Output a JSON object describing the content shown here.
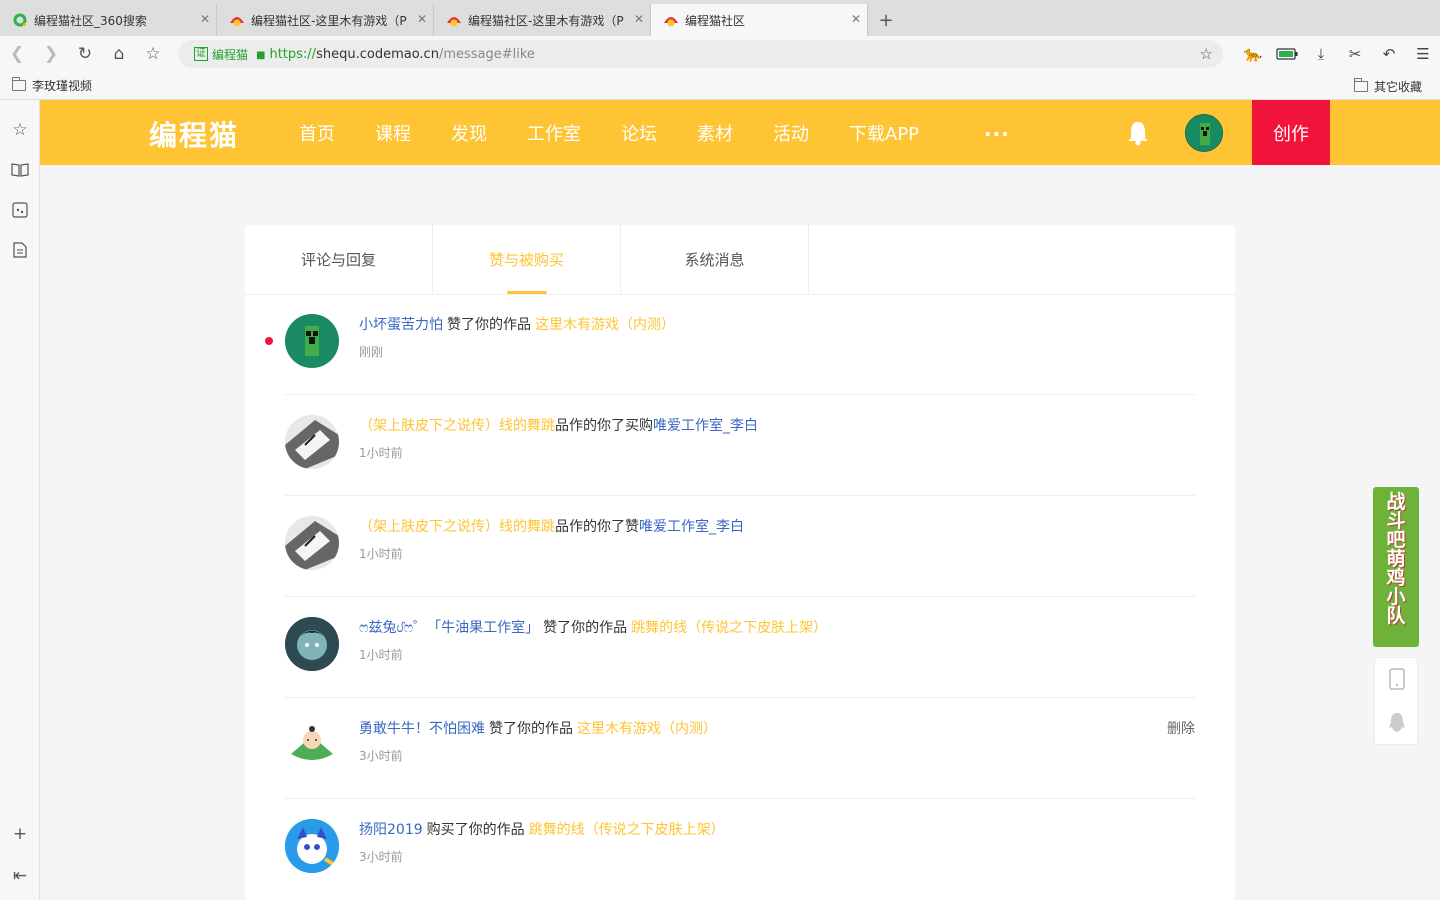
{
  "browser": {
    "tabs": [
      {
        "title": "编程猫社区_360搜索",
        "active": false
      },
      {
        "title": "编程猫社区-这里木有游戏（P",
        "active": false
      },
      {
        "title": "编程猫社区-这里木有游戏（P",
        "active": false
      },
      {
        "title": "编程猫社区",
        "active": true
      }
    ],
    "new_tab": "+",
    "cert_label": "证",
    "cert_site": "编程猫",
    "url_protocol": "https://",
    "url_host": "shequ.codemao.cn",
    "url_path": "/message#like",
    "bookmarks": [
      "李玫瑾视频"
    ],
    "bookmarks_other": "其它收藏"
  },
  "site": {
    "logo": "编程猫",
    "nav": [
      "首页",
      "课程",
      "发现",
      "工作室",
      "论坛",
      "素材",
      "活动",
      "下载APP"
    ],
    "more": "···",
    "create": "创作",
    "brand_color": "#fec433",
    "create_color": "#f1133a"
  },
  "tabs": [
    {
      "label": "评论与回复",
      "active": false
    },
    {
      "label": "赞与被购买",
      "active": true
    },
    {
      "label": "系统消息",
      "active": false
    }
  ],
  "messages": [
    {
      "user": "小坏蛋苦力怕",
      "action": "赞了你的作品",
      "work": "这里木有游戏（内测）",
      "time": "刚刚",
      "unread": true,
      "avatar": "creeper-avatar"
    },
    {
      "work": "（架上肤皮下之说传）线的舞跳",
      "action": "品作的你了买购",
      "user": "唯爱工作室_李白",
      "time": "1小时前",
      "avatar": "sketch-avatar"
    },
    {
      "work": "（架上肤皮下之说传）线的舞跳",
      "action": "品作的你了赞",
      "user": "唯爱工作室_李白",
      "time": "1小时前",
      "avatar": "sketch-avatar"
    },
    {
      "user": "ෆ兹兔ᦔෆ゜「牛油果工作室」",
      "action": "赞了你的作品",
      "work": "跳舞的线（传说之下皮肤上架）",
      "time": "1小时前",
      "avatar": "anime-avatar"
    },
    {
      "user": "勇敢牛牛！不怕困难",
      "action": "赞了你的作品",
      "work": "这里木有游戏（内测）",
      "time": "3小时前",
      "avatar": "zongzi-avatar",
      "delete": "删除"
    },
    {
      "user": "扬阳2019",
      "action": "购买了你的作品",
      "work": "跳舞的线（传说之下皮肤上架）",
      "time": "3小时前",
      "avatar": "cat-avatar"
    }
  ],
  "ad": {
    "text": "战斗吧萌鸡小队"
  }
}
